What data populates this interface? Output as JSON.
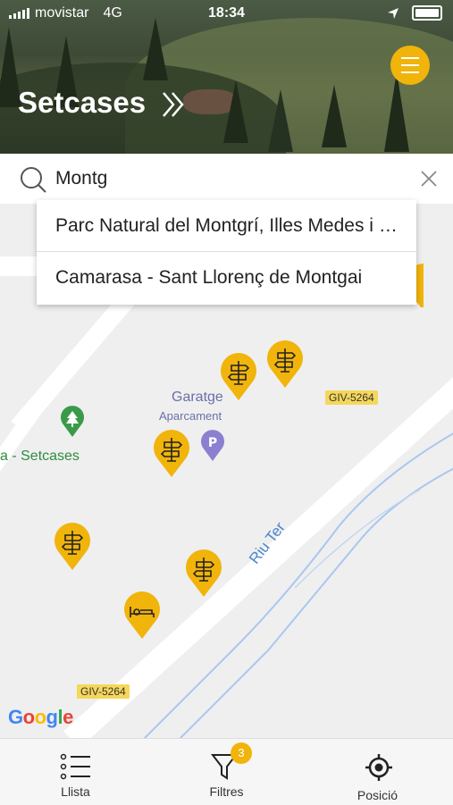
{
  "status_bar": {
    "carrier": "movistar",
    "network": "4G",
    "time": "18:34"
  },
  "header": {
    "title": "Setcases"
  },
  "search": {
    "value": "Montg",
    "placeholder": ""
  },
  "suggestions": [
    "Parc Natural del Montgrí, Illes Medes i del Baix Ter",
    "Camarasa - Sant Llorenç de Montgai"
  ],
  "map": {
    "places": {
      "garage_name": "Garatge",
      "garage_type": "Aparcament",
      "park_label": "a - Setcases",
      "river": "Riu Ter"
    },
    "roads": [
      "GIV-5264",
      "GIV-5264"
    ],
    "attribution": "Google",
    "colors": {
      "pin": "#f1b40b",
      "park": "#3a9a4a",
      "parking": "#8a7fd1",
      "river": "#a9c7ef"
    }
  },
  "tabs": [
    {
      "label": "Llista",
      "icon": "list-icon"
    },
    {
      "label": "Filtres",
      "icon": "filter-icon",
      "badge": "3"
    },
    {
      "label": "Posició",
      "icon": "locate-icon"
    }
  ],
  "colors": {
    "accent": "#f1b40b"
  }
}
